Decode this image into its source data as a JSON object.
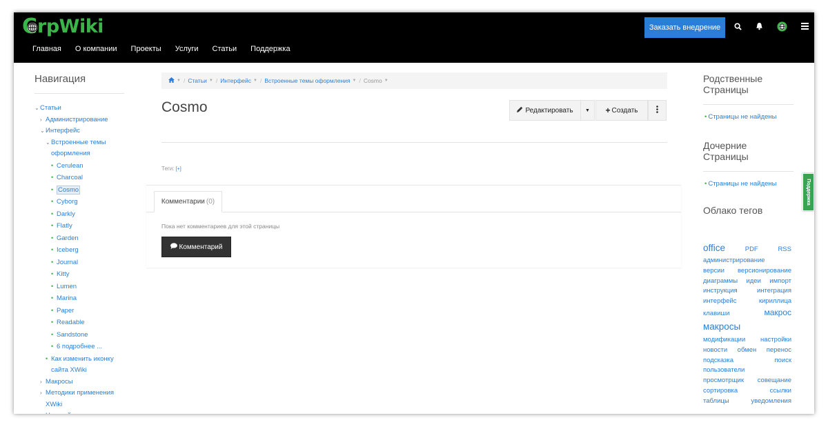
{
  "header": {
    "logo_letter": "C",
    "logo_text": "rpWiki",
    "order_button": "Заказать внедрение",
    "icons": [
      "search-icon",
      "bell-icon",
      "globe-icon",
      "menu-icon"
    ],
    "nav": [
      "Главная",
      "О компании",
      "Проекты",
      "Услуги",
      "Статьи",
      "Поддержка"
    ]
  },
  "left_nav": {
    "title": "Навигация",
    "items": [
      {
        "label": "Статьи",
        "level": 0,
        "type": "open"
      },
      {
        "label": "Администрирование",
        "level": 1,
        "type": "closed"
      },
      {
        "label": "Интерфейс",
        "level": 1,
        "type": "open"
      },
      {
        "label": "Встроенные темы",
        "level": 2,
        "type": "open"
      },
      {
        "label": "оформления",
        "level": 2,
        "type": "cont"
      },
      {
        "label": "Cerulean",
        "level": 3,
        "type": "dot"
      },
      {
        "label": "Charcoal",
        "level": 3,
        "type": "dot"
      },
      {
        "label": "Cosmo",
        "level": 3,
        "type": "dot",
        "selected": true
      },
      {
        "label": "Cyborg",
        "level": 3,
        "type": "dot"
      },
      {
        "label": "Darkly",
        "level": 3,
        "type": "dot"
      },
      {
        "label": "Flatly",
        "level": 3,
        "type": "dot"
      },
      {
        "label": "Garden",
        "level": 3,
        "type": "dot"
      },
      {
        "label": "Iceberg",
        "level": 3,
        "type": "dot"
      },
      {
        "label": "Journal",
        "level": 3,
        "type": "dot"
      },
      {
        "label": "Kitty",
        "level": 3,
        "type": "dot"
      },
      {
        "label": "Lumen",
        "level": 3,
        "type": "dot"
      },
      {
        "label": "Marina",
        "level": 3,
        "type": "dot"
      },
      {
        "label": "Paper",
        "level": 3,
        "type": "dot"
      },
      {
        "label": "Readable",
        "level": 3,
        "type": "dot"
      },
      {
        "label": "Sandstone",
        "level": 3,
        "type": "dot"
      },
      {
        "label": "6 подробнее ...",
        "level": 3,
        "type": "dot"
      },
      {
        "label": "Как изменить иконку",
        "level": 2,
        "type": "dot"
      },
      {
        "label": "сайта XWiki",
        "level": 2,
        "type": "cont"
      },
      {
        "label": "Макросы",
        "level": 1,
        "type": "closed"
      },
      {
        "label": "Методики применения",
        "level": 1,
        "type": "closed"
      },
      {
        "label": "XWiki",
        "level": 1,
        "type": "cont"
      },
      {
        "label": "Настройки и",
        "level": 1,
        "type": "closed"
      }
    ]
  },
  "breadcrumb": [
    "Статьи",
    "Интерфейс",
    "Встроенные темы оформления",
    "Cosmo"
  ],
  "page": {
    "title": "Cosmo",
    "edit_button": "Редактировать",
    "create_button": "Создать",
    "tags_label": "Теги:",
    "tags_add": "[+]",
    "comments_tab": "Комментарии",
    "comments_count": "(0)",
    "no_comments": "Пока нет комментариев для этой страницы",
    "comment_button": "Комментарий"
  },
  "right_col": {
    "related_title_1": "Родственные",
    "related_title_2": "Страницы",
    "related_empty": "Страницы не найдены",
    "children_title_1": "Дочерние",
    "children_title_2": "Страницы",
    "children_empty": "Страницы не найдены",
    "tagcloud_title": "Облако тегов"
  },
  "tag_cloud": [
    {
      "tags": [
        "office",
        "PDF",
        "RSS"
      ],
      "size": "big-first"
    },
    {
      "tags": [
        "администрирование"
      ]
    },
    {
      "tags": [
        "версии",
        "версионирование"
      ]
    },
    {
      "tags": [
        "диаграммы",
        "идеи",
        "импорт"
      ]
    },
    {
      "tags": [
        "инструкция",
        "интеграция"
      ]
    },
    {
      "tags": [
        "интерфейс",
        "кириллица"
      ]
    },
    {
      "tags": [
        "клавиши",
        "макрос"
      ],
      "size": "mid"
    },
    {
      "tags": [
        "макросы"
      ],
      "size": "big"
    },
    {
      "tags": [
        "модификации",
        "настройки"
      ]
    },
    {
      "tags": [
        "новости",
        "обмен",
        "перенос"
      ]
    },
    {
      "tags": [
        "подсказка",
        "поиск"
      ]
    },
    {
      "tags": [
        "пользователи"
      ]
    },
    {
      "tags": [
        "просмотрщик",
        "совещание"
      ]
    },
    {
      "tags": [
        "сортировка",
        "ссылки"
      ]
    },
    {
      "tags": [
        "таблицы",
        "уведомления"
      ]
    }
  ],
  "support_tab": "Поддержка",
  "colors": {
    "accent": "#2a7ed8",
    "brand": "#3bb54a",
    "header_bg": "#000000"
  }
}
